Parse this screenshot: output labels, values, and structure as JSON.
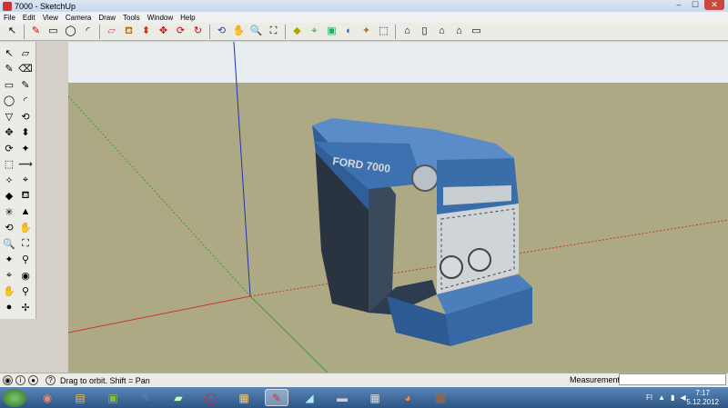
{
  "window": {
    "title": "7000 - SketchUp"
  },
  "window_controls": {
    "minimize": "–",
    "maximize": "☐",
    "close": "✕"
  },
  "menu": [
    "File",
    "Edit",
    "View",
    "Camera",
    "Draw",
    "Tools",
    "Window",
    "Help"
  ],
  "toolbar_top": {
    "icons": [
      "select-icon",
      "pencil-icon",
      "rectangle-icon",
      "circle-icon",
      "arc-icon",
      "eraser-icon",
      "paint-bucket-icon",
      "push-pull-icon",
      "move-icon",
      "rotate-icon",
      "follow-me-icon",
      "orbit-icon",
      "pan-icon",
      "zoom-icon",
      "zoom-extents-icon",
      "components-icon",
      "geolocation-icon",
      "photo-textures-icon",
      "warehouse-icon",
      "extension-icon",
      "iso-view-icon",
      "top-view-icon",
      "front-view-icon",
      "right-view-icon",
      "back-view-icon",
      "left-view-icon"
    ]
  },
  "toolbar_left": {
    "icon_count": 34
  },
  "model": {
    "front_label": "FORD 7000",
    "colors": {
      "sky": "#e8edef",
      "ground": "#aea985",
      "body_blue": "#3a6ea8",
      "body_dark": "#1e3a5c",
      "grille": "#cfd4d8",
      "axis_red": "#c8362a",
      "axis_green": "#3a9a3a",
      "axis_blue": "#2030b8"
    }
  },
  "status": {
    "hint": "Drag to orbit.  Shift = Pan",
    "measurements_label": "Measurements",
    "measurements_value": ""
  },
  "taskbar": {
    "tray_lang": "FI",
    "time": "7:17",
    "date": "5.12.2012"
  }
}
